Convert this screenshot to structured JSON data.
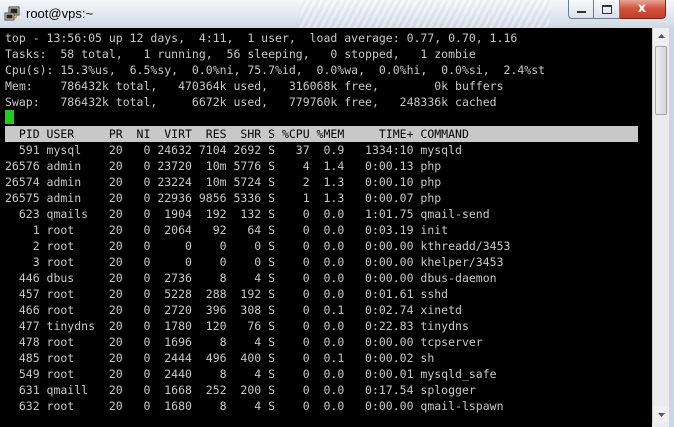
{
  "window": {
    "title": "root@vps:~",
    "icons": {
      "app": "putty-icon",
      "minimize": "minimize-icon",
      "maximize": "maximize-icon",
      "close": "close-icon"
    },
    "close_glyph": "x"
  },
  "colors": {
    "terminal_bg": "#000000",
    "terminal_fg": "#c8c8c8",
    "cursor": "#1ecc1e",
    "header_bg": "#c8c8c8",
    "close_button": "#c94a33"
  },
  "top_summary": [
    "top - 13:56:05 up 12 days,  4:11,  1 user,  load average: 0.77, 0.70, 1.16",
    "Tasks:  58 total,   1 running,  56 sleeping,   0 stopped,   1 zombie",
    "Cpu(s): 15.3%us,  6.5%sy,  0.0%ni, 75.7%id,  0.0%wa,  0.0%hi,  0.0%si,  2.4%st",
    "Mem:    786432k total,   470364k used,   316068k free,        0k buffers",
    "Swap:   786432k total,     6672k used,   779760k free,   248336k cached"
  ],
  "process_table": {
    "columns": [
      "PID",
      "USER",
      "PR",
      "NI",
      "VIRT",
      "RES",
      "SHR",
      "S",
      "%CPU",
      "%MEM",
      "TIME+",
      "COMMAND"
    ],
    "rows": [
      [
        "591",
        "mysql",
        "20",
        "0",
        "24632",
        "7104",
        "2692",
        "S",
        "37",
        "0.9",
        "1334:10",
        "mysqld"
      ],
      [
        "26576",
        "admin",
        "20",
        "0",
        "23720",
        "10m",
        "5776",
        "S",
        "4",
        "1.4",
        "0:00.13",
        "php"
      ],
      [
        "26574",
        "admin",
        "20",
        "0",
        "23224",
        "10m",
        "5724",
        "S",
        "2",
        "1.3",
        "0:00.10",
        "php"
      ],
      [
        "26575",
        "admin",
        "20",
        "0",
        "22936",
        "9856",
        "5336",
        "S",
        "1",
        "1.3",
        "0:00.07",
        "php"
      ],
      [
        "623",
        "qmails",
        "20",
        "0",
        "1904",
        "192",
        "132",
        "S",
        "0",
        "0.0",
        "1:01.75",
        "qmail-send"
      ],
      [
        "1",
        "root",
        "20",
        "0",
        "2064",
        "92",
        "64",
        "S",
        "0",
        "0.0",
        "0:03.19",
        "init"
      ],
      [
        "2",
        "root",
        "20",
        "0",
        "0",
        "0",
        "0",
        "S",
        "0",
        "0.0",
        "0:00.00",
        "kthreadd/3453"
      ],
      [
        "3",
        "root",
        "20",
        "0",
        "0",
        "0",
        "0",
        "S",
        "0",
        "0.0",
        "0:00.00",
        "khelper/3453"
      ],
      [
        "446",
        "dbus",
        "20",
        "0",
        "2736",
        "8",
        "4",
        "S",
        "0",
        "0.0",
        "0:00.00",
        "dbus-daemon"
      ],
      [
        "457",
        "root",
        "20",
        "0",
        "5228",
        "288",
        "192",
        "S",
        "0",
        "0.0",
        "0:01.61",
        "sshd"
      ],
      [
        "466",
        "root",
        "20",
        "0",
        "2720",
        "396",
        "308",
        "S",
        "0",
        "0.1",
        "0:02.74",
        "xinetd"
      ],
      [
        "477",
        "tinydns",
        "20",
        "0",
        "1780",
        "120",
        "76",
        "S",
        "0",
        "0.0",
        "0:22.83",
        "tinydns"
      ],
      [
        "478",
        "root",
        "20",
        "0",
        "1696",
        "8",
        "4",
        "S",
        "0",
        "0.0",
        "0:00.00",
        "tcpserver"
      ],
      [
        "485",
        "root",
        "20",
        "0",
        "2444",
        "496",
        "400",
        "S",
        "0",
        "0.1",
        "0:00.02",
        "sh"
      ],
      [
        "549",
        "root",
        "20",
        "0",
        "2440",
        "8",
        "4",
        "S",
        "0",
        "0.0",
        "0:00.01",
        "mysqld_safe"
      ],
      [
        "631",
        "qmaill",
        "20",
        "0",
        "1668",
        "252",
        "200",
        "S",
        "0",
        "0.0",
        "0:17.54",
        "splogger"
      ],
      [
        "632",
        "root",
        "20",
        "0",
        "1680",
        "8",
        "4",
        "S",
        "0",
        "0.0",
        "0:00.00",
        "qmail-lspawn"
      ]
    ]
  },
  "scrollbar": {
    "position": 0.0,
    "visible_fraction": 0.19
  }
}
